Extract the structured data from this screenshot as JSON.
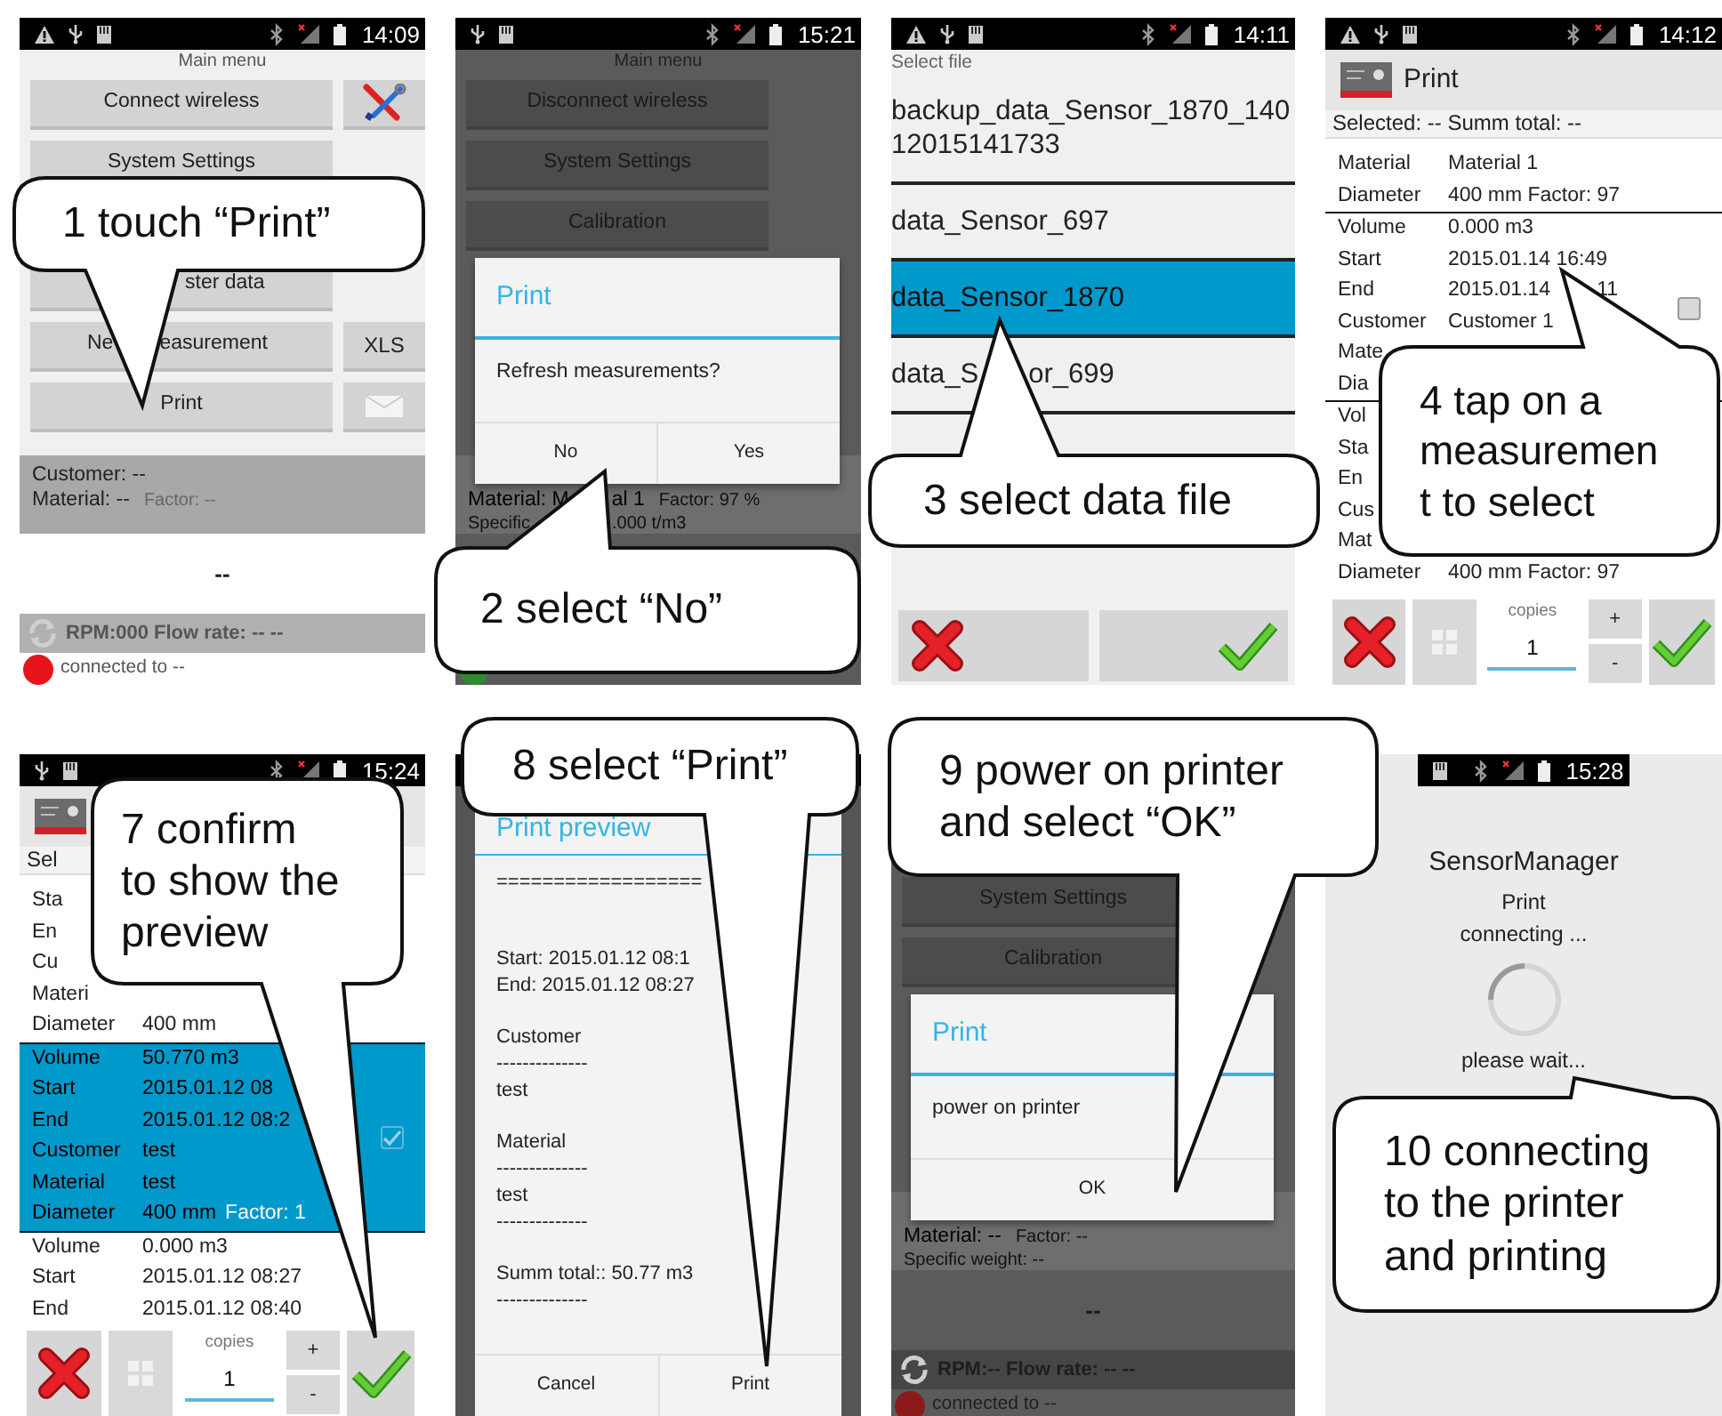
{
  "panels": [
    {
      "kind": "main_menu",
      "dimmed": false,
      "status": {
        "left_icons": [
          {
            "kind": "warning"
          },
          {
            "kind": "usb"
          },
          {
            "kind": "storage"
          }
        ],
        "time": "14:09"
      },
      "title": "Main menu",
      "rows": [
        {
          "kind": "button",
          "label": "Connect wireless",
          "side": {
            "kind": "tools"
          }
        },
        {
          "kind": "button",
          "label": "System Settings"
        },
        {
          "kind": "covered"
        },
        {
          "kind": "button",
          "label": "ster data"
        },
        {
          "kind": "button",
          "label": [
            "Ne",
            "easurement"
          ],
          "side": {
            "kind": "text",
            "text": "XLS"
          }
        },
        {
          "kind": "button",
          "label": "Print",
          "side": {
            "kind": "mail"
          }
        }
      ],
      "info": [
        {
          "kind": "main",
          "text": "Customer: --"
        },
        {
          "kind": "main",
          "text": "Material: --",
          "note": "Factor: --"
        }
      ],
      "value": "--",
      "rpm": "RPM:000 Flow rate: -- --",
      "connection": {
        "text": "connected to --",
        "color": "#e8141c"
      }
    },
    {
      "kind": "main_menu",
      "dimmed": true,
      "status": {
        "left_icons": [
          {
            "kind": "usb"
          },
          {
            "kind": "storage"
          }
        ],
        "time": "15:21"
      },
      "title": "Main menu",
      "rows": [
        {
          "kind": "button",
          "label": "Disconnect wireless"
        },
        {
          "kind": "button",
          "label": "System Settings"
        },
        {
          "kind": "button",
          "label": "Calibration"
        }
      ],
      "info": [
        {
          "kind": "covered"
        },
        {
          "kind": "main",
          "text": [
            "Material: M",
            "al 1"
          ],
          "note": "Factor: 97 %"
        },
        {
          "kind": "minor",
          "text": [
            "Specific",
            ".000 t/m3"
          ]
        }
      ],
      "connection": {
        "color": "#2e8b2e"
      },
      "dialog": {
        "title": "Print",
        "message": "Refresh measurements?",
        "buttons": [
          "No",
          "Yes"
        ]
      }
    },
    {
      "kind": "file_list",
      "status": {
        "left_icons": [
          {
            "kind": "warning"
          },
          {
            "kind": "usb"
          },
          {
            "kind": "storage"
          }
        ],
        "time": "14:11"
      },
      "heading": "Select file",
      "files": [
        {
          "name": "backup_data_Sensor_1870_14012015141733",
          "selected": false
        },
        {
          "name": "data_Sensor_697",
          "selected": false
        },
        {
          "name": "data_Sensor_1870",
          "selected": true
        },
        {
          "name": [
            "data_S",
            "or_699"
          ],
          "selected": false
        }
      ],
      "actions": [
        {
          "kind": "cancel"
        },
        {
          "kind": "confirm"
        }
      ]
    },
    {
      "kind": "records",
      "status": {
        "left_icons": [
          {
            "kind": "warning"
          },
          {
            "kind": "usb"
          },
          {
            "kind": "storage"
          }
        ],
        "time": "14:12"
      },
      "title": "Print",
      "summary": "Selected: -- Summ total: --",
      "records": [
        {
          "selected": false,
          "rows": [
            {
              "label": "Material",
              "value": "Material 1"
            },
            {
              "label": "Diameter",
              "value": "400 mm Factor: 97"
            }
          ]
        },
        {
          "selected": false,
          "checked": false,
          "rows": [
            {
              "label": "Volume",
              "value": "0.000 m3"
            },
            {
              "label": "Start",
              "value": "2015.01.14 16:49"
            },
            {
              "label": "End",
              "value": [
                "2015.01.14",
                "11"
              ]
            },
            {
              "label": "Customer",
              "value": "Customer 1"
            },
            {
              "label": "Mate"
            },
            {
              "label": "Dia"
            }
          ]
        },
        {
          "selected": false,
          "rows": [
            {
              "label": "Vol"
            },
            {
              "label": "Sta"
            },
            {
              "label": "En"
            },
            {
              "label": "Cus"
            },
            {
              "label": "Mat"
            },
            {
              "label": "Diameter",
              "value": "400 mm Factor: 97"
            }
          ]
        }
      ],
      "footer": {
        "copies_label": "copies",
        "copies": "1",
        "plus": "+",
        "minus": "-"
      }
    },
    {
      "kind": "records",
      "status": {
        "left_icons": [
          {
            "kind": "usb"
          },
          {
            "kind": "storage"
          }
        ],
        "time": "15:24"
      },
      "summary": "Sel",
      "records": [
        {
          "selected": false,
          "rows": [
            {
              "label": "Sta"
            },
            {
              "label": "En"
            },
            {
              "label": "Cu"
            },
            {
              "label": "Materi"
            },
            {
              "label": "Diameter",
              "value": "400 mm"
            }
          ]
        },
        {
          "selected": true,
          "checked": true,
          "rows": [
            {
              "label": "Volume",
              "value": "50.770 m3"
            },
            {
              "label": "Start",
              "value": "2015.01.12 08"
            },
            {
              "label": "End",
              "value": "2015.01.12 08:2"
            },
            {
              "label": "Customer",
              "value": "test"
            },
            {
              "label": "Material",
              "value": "test"
            },
            {
              "label": "Diameter",
              "value": "400 mm",
              "note": "Factor: 1"
            }
          ]
        },
        {
          "selected": false,
          "rows": [
            {
              "label": "Volume",
              "value": "0.000 m3"
            },
            {
              "label": "Start",
              "value": "2015.01.12 08:27"
            },
            {
              "label": "End",
              "value": "2015.01.12 08:40"
            }
          ]
        }
      ],
      "footer": {
        "copies_label": "copies",
        "copies": "1",
        "plus": "+",
        "minus": "-"
      }
    },
    {
      "kind": "preview",
      "dialog": {
        "title": "Print preview",
        "groups": [
          [
            "=================="
          ],
          [
            "Start: 2015.01.12 08:1",
            "End: 2015.01.12 08:27"
          ],
          [
            "Customer",
            "--------------",
            "test"
          ],
          [
            "Material",
            "--------------",
            "test",
            "--------------"
          ],
          [
            "Summ total:: 50.77 m3",
            "--------------"
          ]
        ],
        "buttons": [
          "Cancel",
          "Print"
        ]
      }
    },
    {
      "kind": "main_menu",
      "dimmed": true,
      "rows": [
        {
          "kind": "covered"
        },
        {
          "kind": "button",
          "label": "System Settings"
        },
        {
          "kind": "button",
          "label": "Calibration"
        }
      ],
      "info": [
        {
          "kind": "covered"
        },
        {
          "kind": "main",
          "text": "Material: --",
          "note": "Factor: --"
        },
        {
          "kind": "minor",
          "text": "Specific weight: --"
        }
      ],
      "value": "--",
      "rpm": "RPM:-- Flow rate: -- --",
      "connection": {
        "text": "connected to --",
        "color": "#8c1a1a"
      },
      "dialog": {
        "title": "Print",
        "message": "power on printer",
        "buttons": [
          "OK"
        ]
      }
    },
    {
      "kind": "progress",
      "status": {
        "left_icons": [
          {
            "kind": "storage"
          }
        ],
        "time": "15:28"
      },
      "app": "SensorManager",
      "title": "Print",
      "message": "connecting ...",
      "wait": "please wait..."
    }
  ],
  "callouts": [
    {
      "lines": [
        "1 touch “Print”"
      ]
    },
    {
      "lines": [
        "2 select “No”"
      ]
    },
    {
      "lines": [
        "3 select data file"
      ]
    },
    {
      "lines": [
        "4 tap on a",
        "measuremen",
        "t to select"
      ]
    },
    {
      "lines": [
        "7 confirm",
        "to show the",
        "preview"
      ]
    },
    {
      "lines": [
        "8 select “Print”"
      ]
    },
    {
      "lines": [
        "9 power on printer",
        "and select “OK”"
      ]
    },
    {
      "lines": [
        "10 connecting",
        "to the printer",
        "and printing"
      ]
    }
  ]
}
